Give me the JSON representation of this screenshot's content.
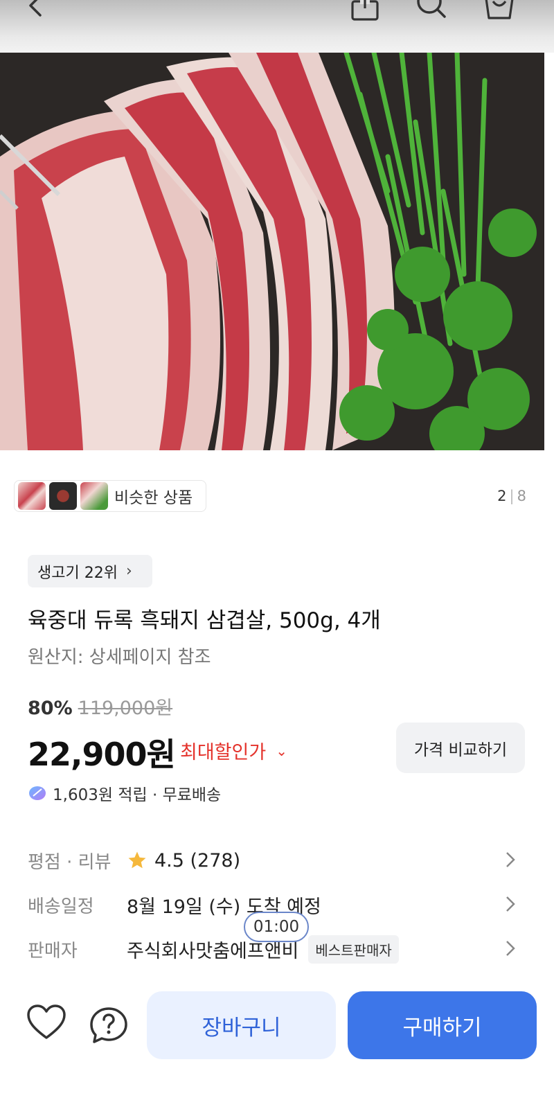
{
  "product": {
    "similar_label": "비슷한 상품",
    "image_index": "2",
    "image_total": "8",
    "rank_chip": "생고기 22위",
    "title": "육중대 듀록 흑돼지 삼겹살, 500g, 4개",
    "origin": "원산지: 상세페이지 참조",
    "discount_pct": "80%",
    "original_price": "119,000원",
    "price": "22,900원",
    "max_discount_label": "최대할인가",
    "compare_button": "가격 비교하기",
    "points_shipping": "1,603원 적립 · 무료배송"
  },
  "info_rows": {
    "rating_label": "평점 · 리뷰",
    "rating_value": "4.5 (278)",
    "delivery_label": "배송일정",
    "delivery_value": "8월 19일 (수) 도착 예정",
    "seller_label": "판매자",
    "seller_value": "주식회사맛춤에프앤비",
    "seller_badge": "베스트판매자"
  },
  "timer": "01:00",
  "actions": {
    "cart_button": "장바구니",
    "buy_button": "구매하기"
  },
  "icons": [
    "back-icon",
    "share-icon",
    "search-icon",
    "bag-icon",
    "star-icon",
    "coin-icon",
    "heart-icon",
    "question-icon",
    "chevron-right-icon"
  ],
  "colors": {
    "accent_blue": "#3d76e9",
    "cart_bg": "#eaf1ff",
    "discount_red": "#e4322b",
    "star": "#f5b83c"
  }
}
